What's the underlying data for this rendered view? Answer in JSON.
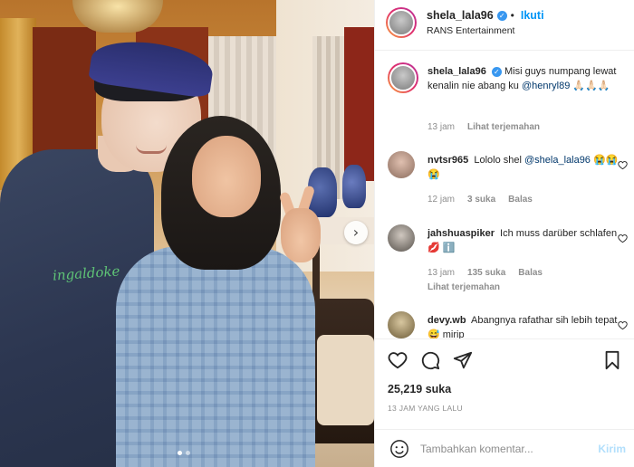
{
  "post": {
    "author": "shela_lala96",
    "follow_label": "Ikuti",
    "location": "RANS Entertainment",
    "caption": {
      "username": "shela_lala96",
      "text": "Misi guys numpang lewat kenalin nie abang ku ",
      "mention": "@henryl89",
      "trail": " 🙏🏻🙏🏻🙏🏻",
      "time": "13 jam",
      "translate": "Lihat terjemahan"
    },
    "comments": [
      {
        "username": "nvtsr965",
        "text": "Lololo shel ",
        "mention": "@shela_lala96",
        "trail": " 😭😭😭",
        "time": "12 jam",
        "likes": "3 suka",
        "reply": "Balas"
      },
      {
        "username": "jahshuaspiker",
        "text": "Ich muss darüber schlafen 💋 ℹ️",
        "time": "13 jam",
        "likes": "135 suka",
        "reply": "Balas",
        "translate": "Lihat terjemahan"
      },
      {
        "username": "devy.wb",
        "text": "Abangnya rafathar sih lebih tepat 😅 mirip"
      }
    ],
    "likes_count": "25,219 suka",
    "timestamp": "13 JAM YANG LALU",
    "comment_placeholder": "Tambahkan komentar...",
    "post_button": "Kirim",
    "shirt_print": "ingaldoke"
  },
  "icons": {
    "like": "heart-icon",
    "comment": "comment-icon",
    "share": "send-icon",
    "save": "bookmark-icon",
    "emoji": "smiley-icon",
    "next": "chevron-right-icon"
  },
  "colors": {
    "accent": "#0095f6",
    "verified": "#3897f0",
    "muted": "#8e8e8e",
    "mention": "#00376b"
  }
}
